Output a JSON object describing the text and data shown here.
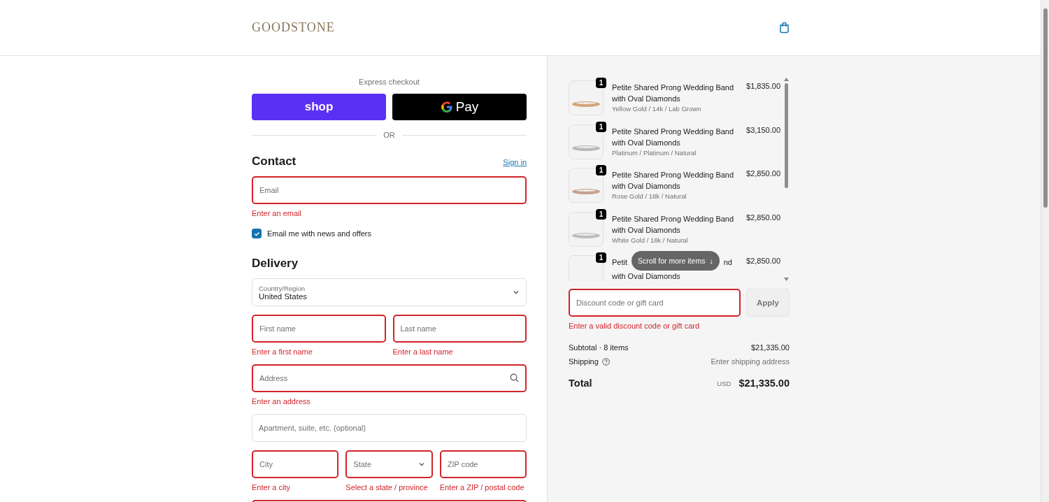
{
  "header": {
    "logo": "GOODSTONE"
  },
  "express": {
    "title": "Express checkout",
    "buttons": [
      {
        "kind": "shop",
        "label": "shop"
      },
      {
        "kind": "gpay",
        "label": "Pay"
      }
    ],
    "divider": "OR"
  },
  "contact": {
    "heading": "Contact",
    "link": "Sign in",
    "email": {
      "placeholder": "Email",
      "error": "Enter an email"
    },
    "newsletter": {
      "label": "Email me with news and offers",
      "checked": true
    }
  },
  "delivery": {
    "heading": "Delivery",
    "country": {
      "label": "Country/Region",
      "value": "United States"
    },
    "rows": [
      [
        {
          "kind": "text",
          "placeholder": "First name",
          "error": "Enter a first name"
        },
        {
          "kind": "text",
          "placeholder": "Last name",
          "error": "Enter a last name"
        }
      ],
      [
        {
          "kind": "search",
          "placeholder": "Address",
          "error": "Enter an address"
        }
      ],
      [
        {
          "kind": "text",
          "placeholder": "Apartment, suite, etc. (optional)"
        }
      ],
      [
        {
          "kind": "text",
          "placeholder": "City",
          "error": "Enter a city"
        },
        {
          "kind": "select",
          "placeholder": "State",
          "error": "Select a state / province"
        },
        {
          "kind": "text",
          "placeholder": "ZIP code",
          "error": "Enter a ZIP / postal code"
        }
      ],
      [
        {
          "kind": "text",
          "invalid": true
        }
      ]
    ]
  },
  "cart": {
    "items": [
      {
        "quantity": "1",
        "title": "Petite Shared Prong Wedding Band with Oval Diamonds",
        "variant": "Yellow Gold / 14k / Lab Grown",
        "price": "$1,835.00",
        "color": "#d2a679"
      },
      {
        "quantity": "1",
        "title": "Petite Shared Prong Wedding Band with Oval Diamonds",
        "variant": "Platinum / Platinum / Natural",
        "price": "$3,150.00",
        "color": "#b8b8b8"
      },
      {
        "quantity": "1",
        "title": "Petite Shared Prong Wedding Band with Oval Diamonds",
        "variant": "Rose Gold / 18k / Natural",
        "price": "$2,850.00",
        "color": "#c9a08f"
      },
      {
        "quantity": "1",
        "title": "Petite Shared Prong Wedding Band with Oval Diamonds",
        "variant": "White Gold / 18k / Natural",
        "price": "$2,850.00",
        "color": "#bdbdbd"
      },
      {
        "quantity": "1",
        "title_start": "Petit",
        "title_end": "nd",
        "title_rest": "with Oval Diamonds",
        "price": "$2,850.00"
      }
    ],
    "scroll_hint": "Scroll for more items",
    "scroll_arrow": "↓"
  },
  "discount": {
    "placeholder": "Discount code or gift card",
    "button": "Apply",
    "error": "Enter a valid discount code or gift card"
  },
  "summary": {
    "subtotal_label": "Subtotal · 8 items",
    "subtotal": "$21,335.00",
    "shipping_label": "Shipping",
    "shipping": "Enter shipping address",
    "total_label": "Total",
    "currency": "USD",
    "total": "$21,335.00"
  }
}
